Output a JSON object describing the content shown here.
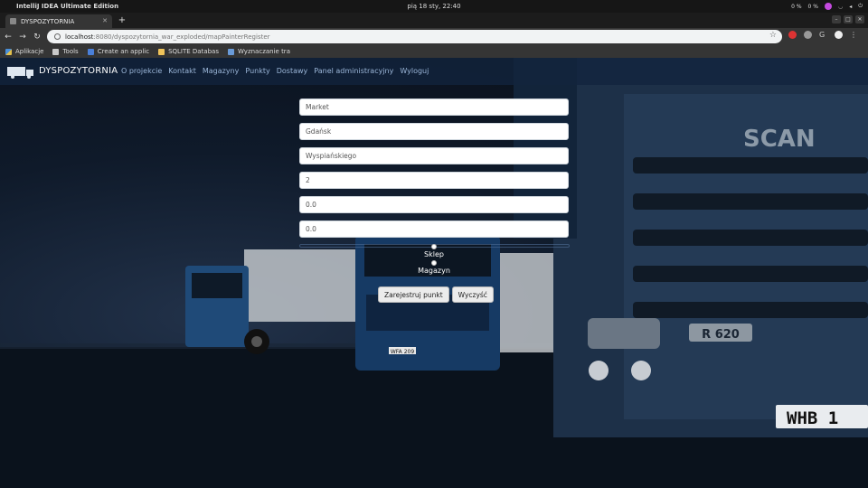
{
  "os": {
    "app_title": "IntelliJ IDEA Ultimate Edition",
    "clock": "pią 18 sty, 22:40",
    "tray_cpu": "0 %",
    "tray_mem": "0 %"
  },
  "browser": {
    "tab_title": "DYSPOZYTORNIA",
    "url_host": "localhost",
    "url_path": ":8080/dyspozytornia_war_exploded/mapPainterRegister",
    "bookmarks": [
      "Aplikacje",
      "Tools",
      "Create an applic",
      "SQLITE Databas",
      "Wyznaczanie tra"
    ]
  },
  "site": {
    "brand": "DYSPOZYTORNIA",
    "menu": [
      "O projekcie",
      "Kontakt",
      "Magazyny",
      "Punkty",
      "Dostawy",
      "Panel administracyjny",
      "Wyloguj"
    ]
  },
  "form": {
    "fields": [
      "Market",
      "Gdańsk",
      "Wyspiańskiego",
      "2",
      "0.0",
      "0.0"
    ],
    "radio_options": [
      "Sklep",
      "Magazyn"
    ],
    "submit_label": "Zarejestruj punkt",
    "clear_label": "Wyczyść"
  },
  "background": {
    "truck_grille_text": "SCAN",
    "truck_model": "R 620",
    "plate_main": "WHB 1",
    "plate_small": "WFA 209"
  },
  "colors": {
    "navbar": "#12243e",
    "nav_link": "#9bb6d8",
    "background_dark": "#0b1420"
  }
}
